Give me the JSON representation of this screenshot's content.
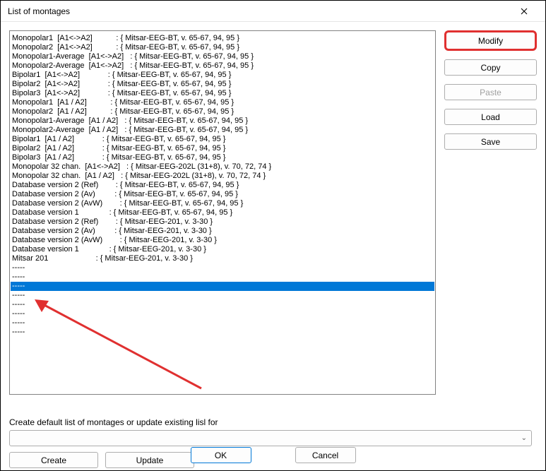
{
  "titlebar": {
    "title": "List of montages"
  },
  "side": {
    "modify": "Modify",
    "copy": "Copy",
    "paste": "Paste",
    "load": "Load",
    "save": "Save"
  },
  "listItems": [
    "Monopolar1  [A1<->A2]           : { Mitsar-EEG-BT, v. 65-67, 94, 95 }",
    "Monopolar2  [A1<->A2]           : { Mitsar-EEG-BT, v. 65-67, 94, 95 }",
    "Monopolar1-Average  [A1<->A2]   : { Mitsar-EEG-BT, v. 65-67, 94, 95 }",
    "Monopolar2-Average  [A1<->A2]   : { Mitsar-EEG-BT, v. 65-67, 94, 95 }",
    "Bipolar1  [A1<->A2]             : { Mitsar-EEG-BT, v. 65-67, 94, 95 }",
    "Bipolar2  [A1<->A2]             : { Mitsar-EEG-BT, v. 65-67, 94, 95 }",
    "Bipolar3  [A1<->A2]             : { Mitsar-EEG-BT, v. 65-67, 94, 95 }",
    "Monopolar1  [A1 / A2]           : { Mitsar-EEG-BT, v. 65-67, 94, 95 }",
    "Monopolar2  [A1 / A2]           : { Mitsar-EEG-BT, v. 65-67, 94, 95 }",
    "Monopolar1-Average  [A1 / A2]   : { Mitsar-EEG-BT, v. 65-67, 94, 95 }",
    "Monopolar2-Average  [A1 / A2]   : { Mitsar-EEG-BT, v. 65-67, 94, 95 }",
    "Bipolar1  [A1 / A2]             : { Mitsar-EEG-BT, v. 65-67, 94, 95 }",
    "Bipolar2  [A1 / A2]             : { Mitsar-EEG-BT, v. 65-67, 94, 95 }",
    "Bipolar3  [A1 / A2]             : { Mitsar-EEG-BT, v. 65-67, 94, 95 }",
    "Monopolar 32 chan.  [A1<->A2]   : { Mitsar-EEG-202L (31+8), v. 70, 72, 74 }",
    "Monopolar 32 chan.  [A1 / A2]   : { Mitsar-EEG-202L (31+8), v. 70, 72, 74 }",
    "Database version 2 (Ref)        : { Mitsar-EEG-BT, v. 65-67, 94, 95 }",
    "Database version 2 (Av)         : { Mitsar-EEG-BT, v. 65-67, 94, 95 }",
    "Database version 2 (AvW)        : { Mitsar-EEG-BT, v. 65-67, 94, 95 }",
    "Database version 1              : { Mitsar-EEG-BT, v. 65-67, 94, 95 }",
    "Database version 2 (Ref)        : { Mitsar-EEG-201, v. 3-30 }",
    "Database version 2 (Av)         : { Mitsar-EEG-201, v. 3-30 }",
    "Database version 2 (AvW)        : { Mitsar-EEG-201, v. 3-30 }",
    "Database version 1              : { Mitsar-EEG-201, v. 3-30 }",
    "Mitsar 201                      : { Mitsar-EEG-201, v. 3-30 }",
    "-----",
    "-----",
    "-----",
    "-----",
    "-----",
    "-----",
    "-----",
    "-----"
  ],
  "selectedIndex": 27,
  "bottom": {
    "label": "Create default list of montages or update existing lisl for",
    "create": "Create",
    "update": "Update"
  },
  "dialog": {
    "ok": "OK",
    "cancel": "Cancel"
  }
}
